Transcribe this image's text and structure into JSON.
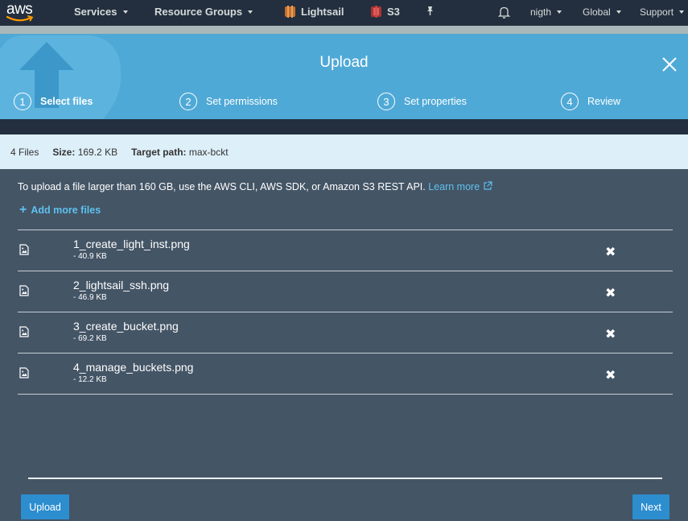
{
  "nav": {
    "logo_text": "aws",
    "services": "Services",
    "resource_groups": "Resource Groups",
    "lightsail": "Lightsail",
    "s3": "S3",
    "user": "nigth",
    "region": "Global",
    "support": "Support",
    "colors": {
      "background": "#232f3e",
      "logo_smile": "#ff9900",
      "lightsail_icon": "#c5712a",
      "s3_icon": "#a93534"
    }
  },
  "modal": {
    "title": "Upload",
    "header_color": "#4fa9d6",
    "steps": [
      {
        "number": "1",
        "label": "Select files",
        "active": true
      },
      {
        "number": "2",
        "label": "Set permissions",
        "active": false
      },
      {
        "number": "3",
        "label": "Set properties",
        "active": false
      },
      {
        "number": "4",
        "label": "Review",
        "active": false
      }
    ]
  },
  "summary": {
    "file_count": "4 Files",
    "size_label": "Size:",
    "size_value": "169.2 KB",
    "target_label": "Target path:",
    "target_value": "max-bckt"
  },
  "info": {
    "text": "To upload a file larger than 160 GB, use the AWS CLI, AWS SDK, or Amazon S3 REST API.",
    "link": "Learn more"
  },
  "add_more": "Add more files",
  "files": [
    {
      "name": "1_create_light_inst.png",
      "size": "- 40.9 KB"
    },
    {
      "name": "2_lightsail_ssh.png",
      "size": "- 46.9 KB"
    },
    {
      "name": "3_create_bucket.png",
      "size": "- 69.2 KB"
    },
    {
      "name": "4_manage_buckets.png",
      "size": "- 12.2 KB"
    }
  ],
  "buttons": {
    "upload": "Upload",
    "next": "Next"
  },
  "icons": [
    "bell-icon",
    "pin-icon",
    "close-icon",
    "image-file-icon",
    "remove-icon",
    "external-link-icon",
    "plus-icon"
  ]
}
